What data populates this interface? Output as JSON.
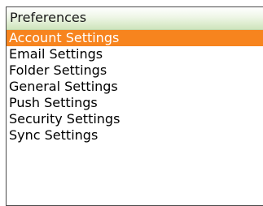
{
  "screen": {
    "title": "Preferences"
  },
  "menu": {
    "items": [
      {
        "label": "Account Settings",
        "selected": true
      },
      {
        "label": "Email Settings",
        "selected": false
      },
      {
        "label": "Folder Settings",
        "selected": false
      },
      {
        "label": "General Settings",
        "selected": false
      },
      {
        "label": "Push Settings",
        "selected": false
      },
      {
        "label": "Security Settings",
        "selected": false
      },
      {
        "label": "Sync Settings",
        "selected": false
      }
    ]
  },
  "colors": {
    "selection": "#f7841e",
    "title_bar": "#cfe4bc"
  }
}
